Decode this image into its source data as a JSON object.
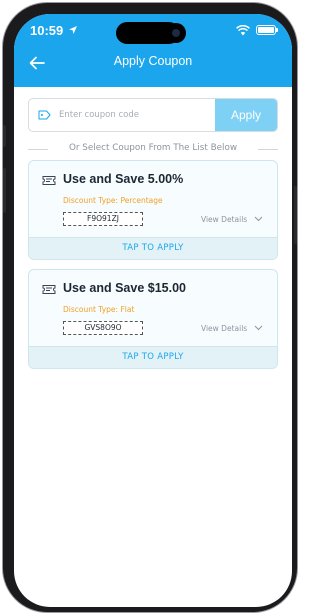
{
  "status_bar": {
    "time": "10:59"
  },
  "header": {
    "title": "Apply Coupon"
  },
  "coupon_entry": {
    "placeholder": "Enter coupon code",
    "value": "",
    "apply_label": "Apply"
  },
  "divider_text": "Or Select Coupon From The List Below",
  "coupons": [
    {
      "title": "Use and Save 5.00%",
      "discount_type": "Discount Type: Percentage",
      "code": "F9O91ZJ",
      "view_details": "View Details",
      "tap_to_apply": "TAP TO APPLY"
    },
    {
      "title": "Use and Save $15.00",
      "discount_type": "Discount Type: Flat",
      "code": "GVS8O9O",
      "view_details": "View Details",
      "tap_to_apply": "TAP TO APPLY"
    }
  ],
  "colors": {
    "header": "#1aa5ec",
    "apply_button": "#7fd0f5",
    "discount_type": "#f0a023",
    "tap_to_apply_text": "#1aa5ec",
    "card_background": "#f7fcfe"
  },
  "icons": {
    "location": "location-arrow-icon",
    "wifi": "wifi-icon",
    "battery": "battery-icon",
    "back": "back-arrow-icon",
    "tag": "tag-icon",
    "ticket": "ticket-icon",
    "chevron": "chevron-down-icon"
  }
}
